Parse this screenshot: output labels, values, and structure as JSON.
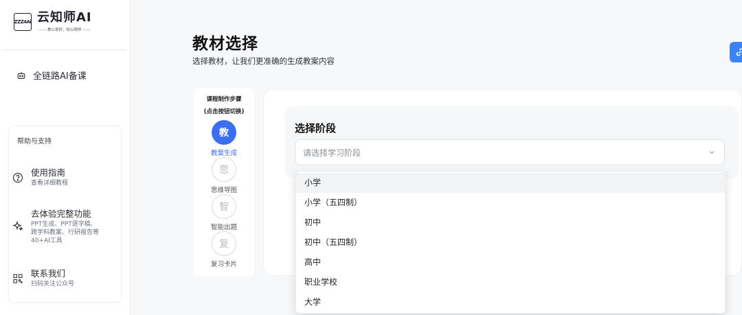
{
  "sidebar": {
    "logo_mark": "ZZZ4Ai",
    "logo_title": "云知师AI",
    "logo_slogan": "—— 教以育桥，知以明师 ——",
    "nav": [
      {
        "label": "全链路AI备课",
        "icon": "robot-icon"
      }
    ],
    "help": {
      "title": "帮助与支持",
      "items": [
        {
          "title": "使用指南",
          "desc": "查看详细教程",
          "icon": "help-circle-icon"
        },
        {
          "title": "去体验完整功能",
          "desc": "PPT生成、PPT逐字稿、跨学科教案、行研报告等40+AI工具",
          "icon": "sparkle-icon"
        },
        {
          "title": "联系我们",
          "desc": "扫码关注公众号",
          "icon": "qrcode-icon"
        }
      ]
    }
  },
  "main": {
    "title": "教材选择",
    "subtitle": "选择教材，让我们更准确的生成教案内容"
  },
  "steps": {
    "title_line1": "课程制作步骤",
    "title_line2": "(点击按钮切换)",
    "items": [
      {
        "char": "教",
        "label": "教案生成",
        "active": true
      },
      {
        "char": "思",
        "label": "思维导图",
        "active": false
      },
      {
        "char": "智",
        "label": "智能出题",
        "active": false
      },
      {
        "char": "复",
        "label": "复习卡片",
        "active": false
      }
    ]
  },
  "stage": {
    "label": "选择阶段",
    "placeholder": "请选择学习阶段",
    "options": [
      "小学",
      "小学（五四制）",
      "初中",
      "初中（五四制）",
      "高中",
      "职业学校",
      "大学"
    ],
    "hovered_index": 0
  },
  "colors": {
    "accent": "#3b6ef0",
    "float_button": "#3b82f6"
  }
}
